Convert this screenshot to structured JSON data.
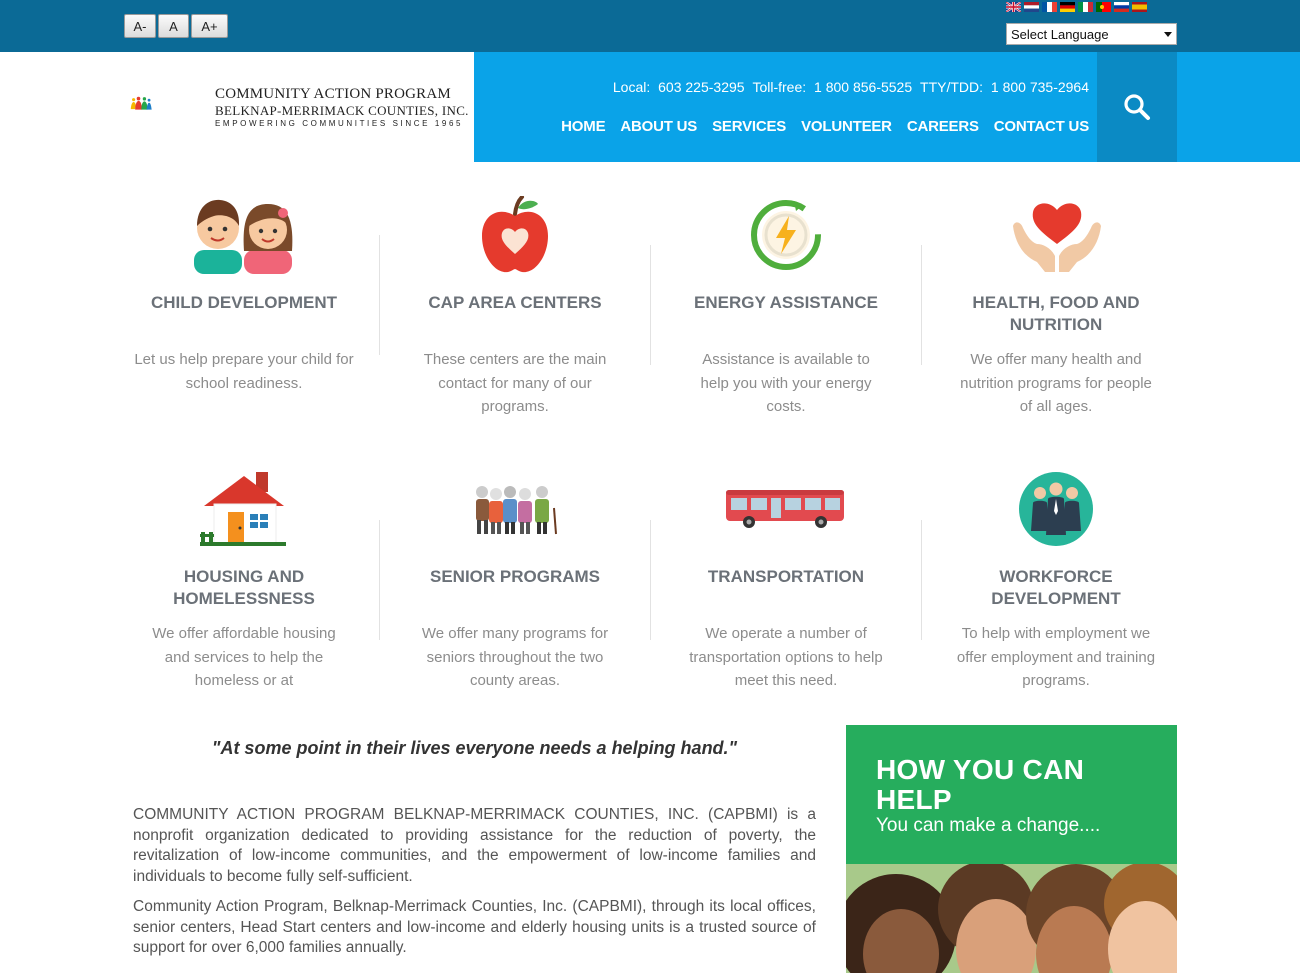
{
  "font_controls": {
    "decrease": "A-",
    "normal": "A",
    "increase": "A+"
  },
  "language": {
    "selected": "Select Language",
    "flags": [
      "english-flag",
      "dutch-flag",
      "french-flag",
      "german-flag",
      "italian-flag",
      "portuguese-flag",
      "russian-flag",
      "spanish-flag"
    ]
  },
  "logo": {
    "line1": "COMMUNITY ACTION PROGRAM",
    "line2": "BELKNAP-MERRIMACK COUNTIES, INC.",
    "tagline": "EMPOWERING COMMUNITIES SINCE 1965"
  },
  "contact": {
    "local_label": "Local:",
    "local": "603 225-3295",
    "tollfree_label": "Toll-free:",
    "tollfree": "1 800 856-5525",
    "tty_label": "TTY/TDD:",
    "tty": "1 800 735-2964"
  },
  "nav": [
    "HOME",
    "ABOUT US",
    "SERVICES",
    "VOLUNTEER",
    "CAREERS",
    "CONTACT US"
  ],
  "services": [
    {
      "title": "CHILD DEVELOPMENT",
      "text": "Let us help prepare your child for school readiness.",
      "icon": "children-icon"
    },
    {
      "title": "CAP AREA CENTERS",
      "text": "These centers are the main contact for many of our programs.",
      "icon": "apple-icon"
    },
    {
      "title": "ENERGY ASSISTANCE",
      "text": "Assistance is available to help you with your energy costs.",
      "icon": "energy-icon"
    },
    {
      "title": "HEALTH, FOOD AND NUTRITION",
      "text": "We offer many health and nutrition programs for people of all ages.",
      "icon": "heart-hands-icon"
    },
    {
      "title": "HOUSING AND HOMELESSNESS",
      "text": "We offer affordable housing and services to help the homeless or at",
      "icon": "house-icon"
    },
    {
      "title": "SENIOR PROGRAMS",
      "text": "We offer many programs for seniors throughout the two county areas.",
      "icon": "seniors-icon"
    },
    {
      "title": "TRANSPORTATION",
      "text": "We operate a number of transportation options to help meet this need.",
      "icon": "bus-icon"
    },
    {
      "title": "WORKFORCE DEVELOPMENT",
      "text": "To help with employment we offer employment and training programs.",
      "icon": "workforce-icon"
    }
  ],
  "quote": "\"At some point in their lives everyone needs a helping hand.\"",
  "about": [
    "COMMUNITY ACTION PROGRAM BELKNAP-MERRIMACK COUNTIES, INC. (CAPBMI) is a nonprofit organization dedicated to providing assistance for the reduction of poverty, the revitalization of low-income communities, and the empowerment of low-income families and individuals to become fully self-sufficient.",
    "Community Action Program, Belknap-Merrimack Counties, Inc. (CAPBMI), through its local offices, senior centers, Head Start centers and low-income and elderly housing units is a trusted source of support for over 6,000 families annually."
  ],
  "help": {
    "title": "HOW YOU CAN HELP",
    "subtitle": "You can make a change...."
  },
  "colors": {
    "topbar": "#0b6a96",
    "nav": "#0aa3e8",
    "search": "#0b8ac4",
    "help": "#26ad5d"
  }
}
